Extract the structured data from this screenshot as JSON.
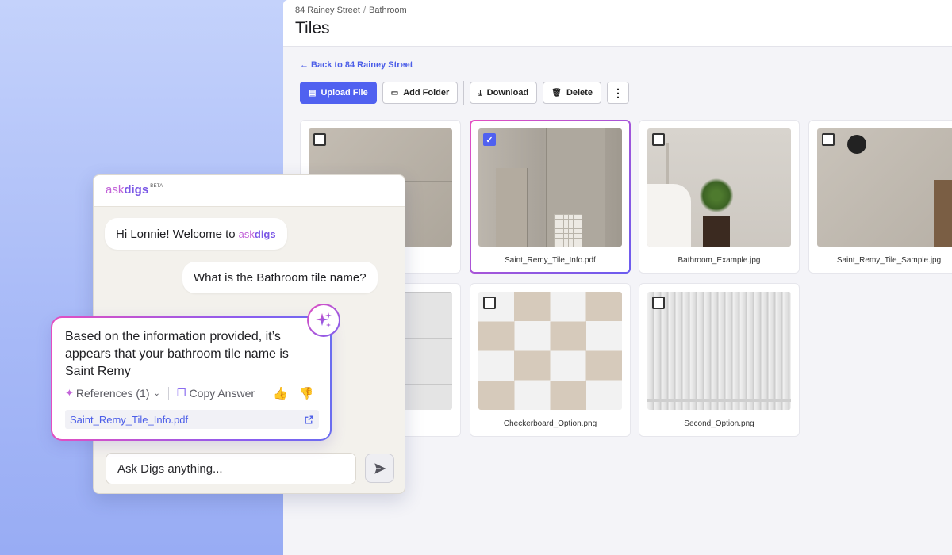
{
  "breadcrumb": {
    "parent": "84 Rainey Street",
    "separator": "/",
    "current": "Bathroom"
  },
  "page_title": "Tiles",
  "back_link": "← Back to 84 Rainey Street",
  "toolbar": {
    "upload": "Upload File",
    "add_folder": "Add Folder",
    "download": "Download",
    "delete": "Delete",
    "more_icon": "more-vertical-icon"
  },
  "files": [
    {
      "name": "Concrete.jpg",
      "visible_label": "ete.jpg",
      "thumb": "concrete",
      "selected": false
    },
    {
      "name": "Saint_Remy_Tile_Info.pdf",
      "visible_label": "Saint_Remy_Tile_Info.pdf",
      "thumb": "remy",
      "selected": true
    },
    {
      "name": "Bathroom_Example.jpg",
      "visible_label": "Bathroom_Example.jpg",
      "thumb": "bath",
      "selected": false
    },
    {
      "name": "Saint_Remy_Tile_Sample.jpg",
      "visible_label": "Saint_Remy_Tile_Sample.jpg",
      "thumb": "sample",
      "selected": false
    },
    {
      "name": "Marble.jpg",
      "visible_label": "re.jpg",
      "thumb": "marble",
      "selected": false
    },
    {
      "name": "Checkerboard_Option.png",
      "visible_label": "Checkerboard_Option.png",
      "thumb": "checker",
      "selected": false
    },
    {
      "name": "Second_Option.png",
      "visible_label": "Second_Option.png",
      "thumb": "finger",
      "selected": false
    }
  ],
  "chat": {
    "brand_ask": "ask",
    "brand_digs": "digs",
    "brand_beta": "BETA",
    "greeting_prefix": "Hi Lonnie! Welcome to",
    "user_message": "What is the Bathroom tile name?",
    "answer": "Based on the information provided, it’s appears that your bathroom tile name is Saint Remy",
    "references_label": "References (1)",
    "copy_label": "Copy Answer",
    "reference_file": "Saint_Remy_Tile_Info.pdf",
    "input_placeholder": "Ask Digs anything..."
  },
  "colors": {
    "accent": "#5061f0",
    "brand_pink": "#c263d8",
    "brand_purple": "#7b58e6"
  }
}
